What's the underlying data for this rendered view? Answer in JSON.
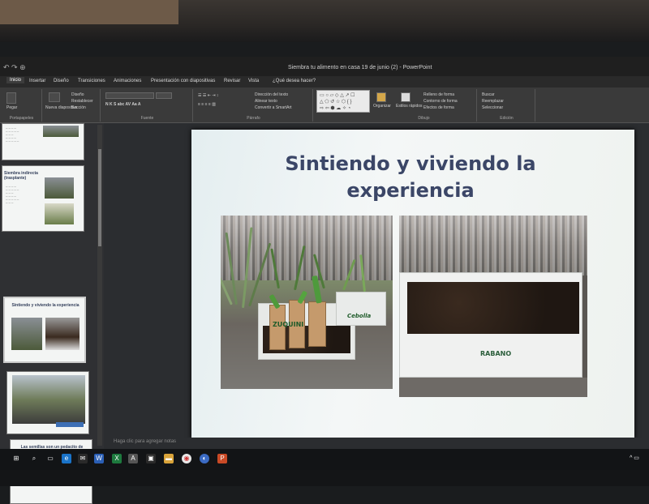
{
  "window": {
    "title": "Siembra tu alimento en casa 19 de junio (2) - PowerPoint"
  },
  "ribbon_tabs": [
    {
      "label": "Inicio",
      "active": true
    },
    {
      "label": "Insertar"
    },
    {
      "label": "Diseño"
    },
    {
      "label": "Transiciones"
    },
    {
      "label": "Animaciones"
    },
    {
      "label": "Presentación con diapositivas"
    },
    {
      "label": "Revisar"
    },
    {
      "label": "Vista"
    },
    {
      "label": "¿Qué desea hacer?"
    }
  ],
  "ribbon_groups": {
    "clipboard": "Portapapeles",
    "font": "Fuente",
    "paragraph": "Párrafo",
    "drawing": "Dibujo",
    "editing": "Edición"
  },
  "ribbon_items": {
    "paste": "Pegar",
    "new_slide": "Nueva diapositiva",
    "design": "Diseño",
    "reset": "Restablecer",
    "section": "Sección",
    "text_direction": "Dirección del texto",
    "align_text": "Alinear texto",
    "convert_smartart": "Convertir a SmartArt",
    "arrange": "Organizar",
    "quick_styles": "Estilos rápidos",
    "shape_fill": "Relleno de forma",
    "shape_outline": "Contorno de forma",
    "shape_effects": "Efectos de forma",
    "find": "Buscar",
    "replace": "Reemplazar",
    "select": "Seleccionar"
  },
  "thumbnails": [
    {
      "num": "",
      "title": ""
    },
    {
      "num": "",
      "title": "Siembra indirecta (trasplante)"
    },
    {
      "num": "",
      "title": "Sintiendo y viviendo la experiencia",
      "selected": true
    },
    {
      "num": "",
      "title": ""
    },
    {
      "num": "",
      "title": "Las semillas son un pedacito de esperanza"
    }
  ],
  "slide": {
    "title": "Sintiendo y viviendo la experiencia",
    "tags": {
      "zucchini": "ZUQUINI",
      "onion": "Cebolla",
      "radish": "RABANO"
    }
  },
  "notes_placeholder": "Haga clic para agregar notas"
}
